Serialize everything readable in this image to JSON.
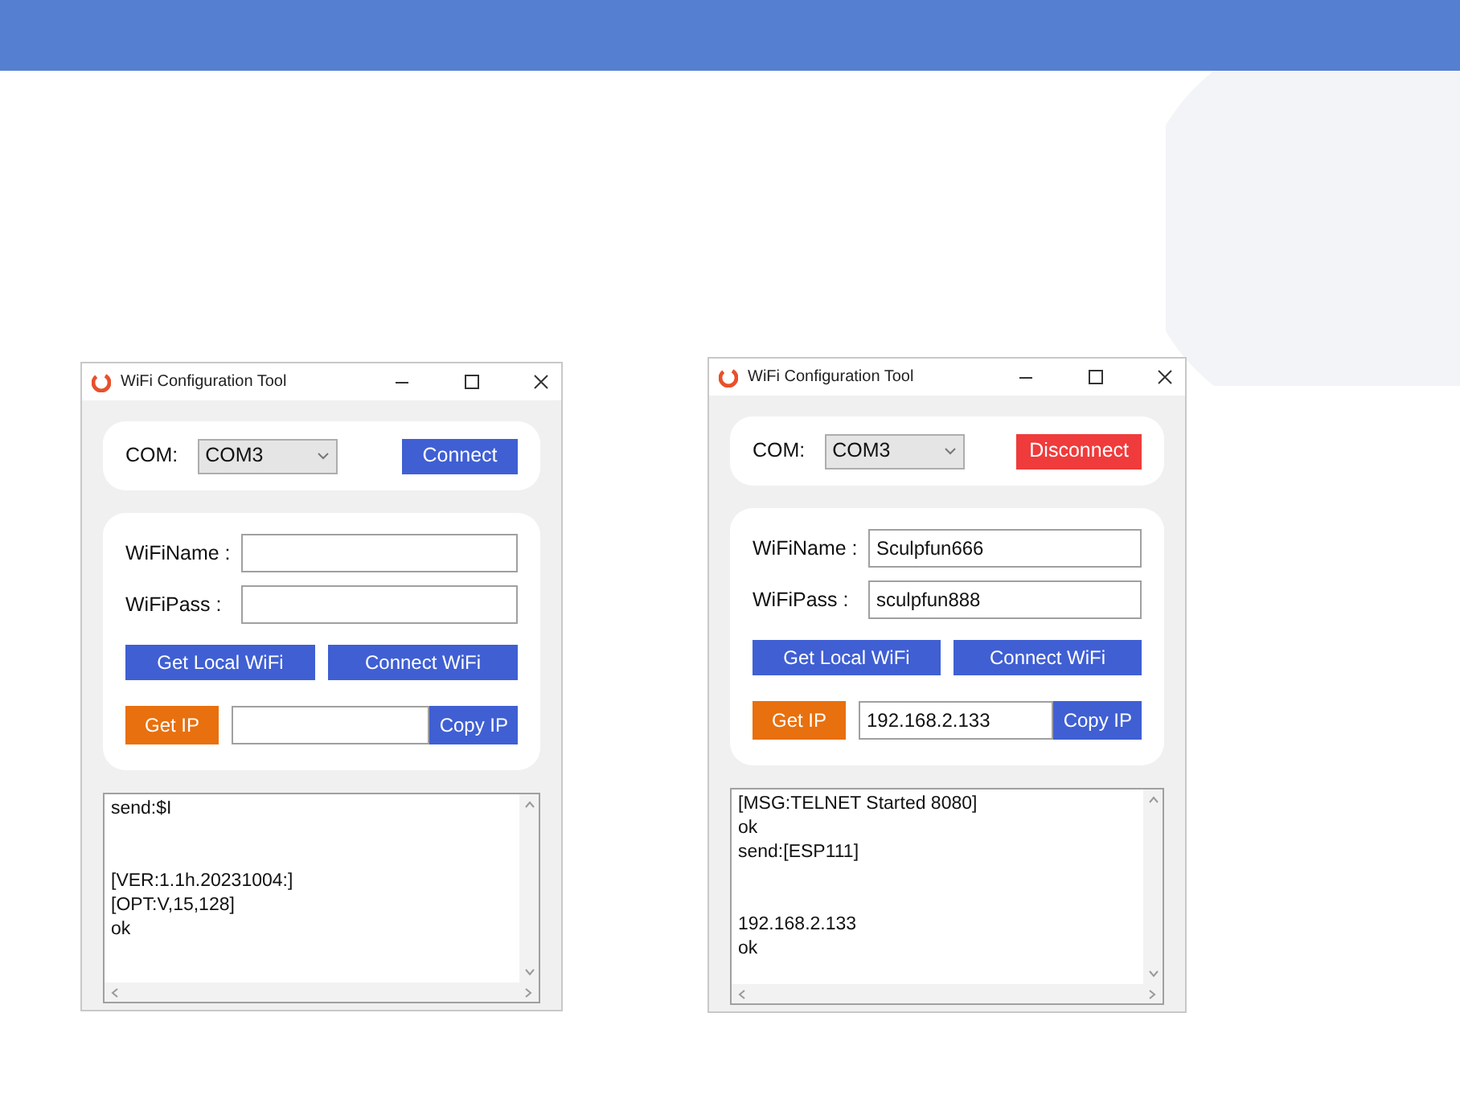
{
  "windows": [
    {
      "title": "WiFi Configuration Tool",
      "com_label": "COM:",
      "com_value": "COM3",
      "connect_button": {
        "label": "Connect",
        "kind": "connect"
      },
      "wifi_name_label": "WiFiName :",
      "wifi_pass_label": "WiFiPass :",
      "get_local_wifi": "Get Local WiFi",
      "connect_wifi": "Connect WiFi",
      "get_ip": "Get IP",
      "copy_ip": "Copy IP",
      "log": [
        {
          "text": "send:$I",
          "gap_before": false
        },
        {
          "text": "[VER:1.1h.20231004:]",
          "gap_before": true
        },
        {
          "text": "[OPT:V,15,128]",
          "gap_before": false
        },
        {
          "text": "ok",
          "gap_before": false
        }
      ]
    },
    {
      "title": "WiFi Configuration Tool",
      "com_label": "COM:",
      "com_value": "COM3",
      "connect_button": {
        "label": "Disconnect",
        "kind": "disconnect"
      },
      "wifi_name_label": "WiFiName :",
      "wifi_name_value": "Sculpfun666",
      "wifi_pass_label": "WiFiPass :",
      "wifi_pass_value": "sculpfun888",
      "get_local_wifi": "Get Local WiFi",
      "connect_wifi": "Connect WiFi",
      "get_ip": "Get IP",
      "ip_value": "192.168.2.133",
      "copy_ip": "Copy IP",
      "log": [
        {
          "text": "[MSG:TELNET Started 8080]",
          "gap_before": false
        },
        {
          "text": "ok",
          "gap_before": false
        },
        {
          "text": "send:[ESP111]",
          "gap_before": false
        },
        {
          "text": "192.168.2.133",
          "gap_before": true
        },
        {
          "text": "ok",
          "gap_before": false
        }
      ]
    }
  ]
}
